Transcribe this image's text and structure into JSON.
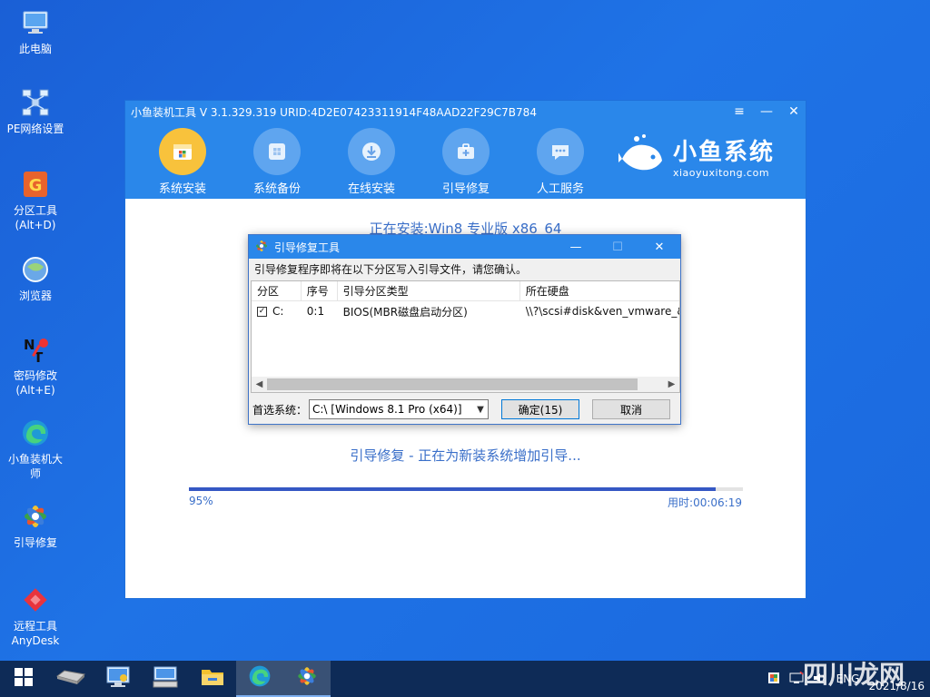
{
  "desktop": {
    "icons": [
      {
        "label": "此电脑",
        "icon": "computer-icon"
      },
      {
        "label": "PE网络设置",
        "icon": "network-icon"
      },
      {
        "label": "分区工具",
        "sub": "(Alt+D)",
        "icon": "partition-tool-icon"
      },
      {
        "label": "浏览器",
        "icon": "browser-icon"
      },
      {
        "label": "密码修改",
        "sub": "(Alt+E)",
        "icon": "password-tool-icon"
      },
      {
        "label": "小鱼装机大师",
        "icon": "edge-icon"
      },
      {
        "label": "引导修复",
        "icon": "boot-repair-icon"
      },
      {
        "label": "远程工具",
        "sub": "AnyDesk",
        "icon": "anydesk-icon"
      }
    ]
  },
  "main_window": {
    "title": "小鱼装机工具 V 3.1.329.319 URID:4D2E07423311914F48AAD22F29C7B784",
    "controls": {
      "menu": "≡",
      "minimize": "—",
      "close": "✕"
    },
    "nav": [
      {
        "label": "系统安装",
        "icon": "system-install-icon",
        "active": true
      },
      {
        "label": "系统备份",
        "icon": "system-backup-icon",
        "active": false
      },
      {
        "label": "在线安装",
        "icon": "online-install-icon",
        "active": false
      },
      {
        "label": "引导修复",
        "icon": "boot-repair-icon",
        "active": false
      },
      {
        "label": "人工服务",
        "icon": "chat-icon",
        "active": false
      }
    ],
    "brand": {
      "name": "小鱼系统",
      "domain": "xiaoyuxitong.com"
    },
    "install_title": "正在安装:Win8 专业版 x86_64",
    "status": "引导修复 - 正在为新装系统增加引导...",
    "progress": {
      "percent_label": "95%",
      "value": 0.95,
      "elapsed": "用时:00:06:19"
    }
  },
  "dialog": {
    "title": "引导修复工具",
    "message": "引导修复程序即将在以下分区写入引导文件，请您确认。",
    "columns": [
      "分区",
      "序号",
      "引导分区类型",
      "所在硬盘"
    ],
    "rows": [
      {
        "partition": "C:",
        "checked": true,
        "index": "0:1",
        "type": "BIOS(MBR磁盘启动分区)",
        "disk": "\\\\?\\scsi#disk&ven_vmware_&"
      }
    ],
    "preferred_label": "首选系统：",
    "preferred_value": "C:\\ [Windows 8.1 Pro (x64)]",
    "confirm_label": "确定(15)",
    "cancel_label": "取消"
  },
  "taskbar": {
    "items": [
      "start-icon",
      "hard-drive-icon",
      "control-panel-icon",
      "keyboard-icon",
      "file-explorer-icon",
      "edge-icon",
      "boot-repair-icon"
    ],
    "tray_lang": "ENG",
    "date": "2021/8/16"
  },
  "watermark": "四川龙网",
  "colors": {
    "accent": "#2a87ea",
    "nav_active": "#f8c23c",
    "progress": "#3557c4",
    "text_blue": "#3a6fc9",
    "taskbar": "#0e2b57"
  }
}
